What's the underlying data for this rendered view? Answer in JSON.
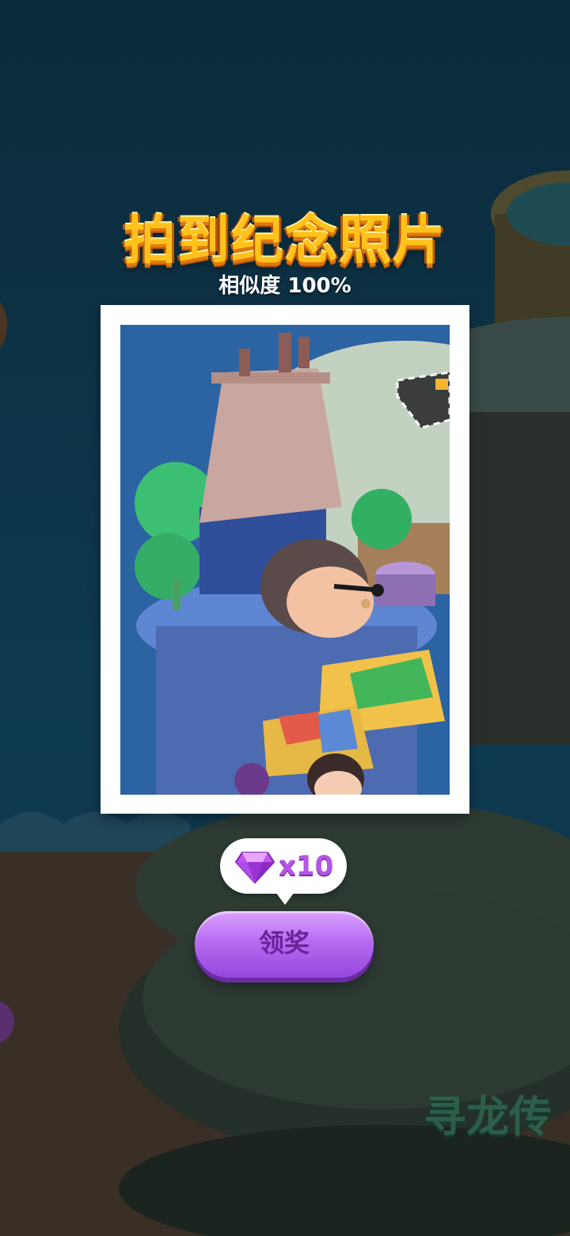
{
  "popup": {
    "title": "拍到纪念照片",
    "similarity": "相似度 100%"
  },
  "reward": {
    "icon": "purple-gem-icon",
    "count_text": "x10"
  },
  "claim_button": {
    "label": "领奖"
  },
  "background": {
    "watermark_text": "寻龙传"
  },
  "colors": {
    "title": "#ffc21a",
    "button": "#b66cf1",
    "gem": "#c455f0"
  }
}
